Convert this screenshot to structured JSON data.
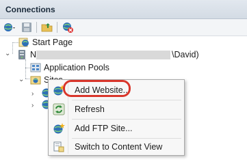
{
  "panel": {
    "title": "Connections"
  },
  "tree": {
    "start_page": "Start Page",
    "server_suffix": "\\David)",
    "app_pools": "Application Pools",
    "sites": "Sites"
  },
  "context_menu": {
    "items": [
      {
        "label": "Add Website...",
        "icon": "globe-add-icon"
      },
      {
        "label": "Refresh",
        "icon": "refresh-icon"
      },
      {
        "label": "Add FTP Site...",
        "icon": "ftp-globe-icon"
      },
      {
        "label": "Switch to Content View",
        "icon": "content-view-icon"
      }
    ]
  },
  "colors": {
    "highlight_ring": "#d9362b",
    "titlebar": "#d3dbe4"
  }
}
